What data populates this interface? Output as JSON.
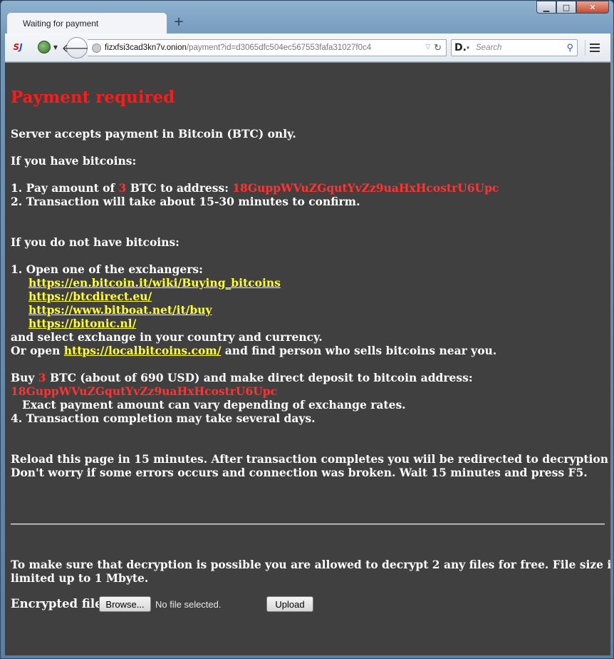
{
  "window": {
    "minimize_label": "▁",
    "maximize_label": "□",
    "close_label": "✕"
  },
  "tab": {
    "title": "Waiting for payment",
    "new_tab_label": "+"
  },
  "toolbar": {
    "addon_icon_text_1": "S",
    "addon_icon_text_2": "J",
    "url_host": "fizxfsi3cad3kn7v.onion",
    "url_path": "/payment?id=d3065dfc504ec567553fafa31027f0c4",
    "search_engine_letter": "D.",
    "search_placeholder": "Search"
  },
  "page": {
    "heading": "Payment required",
    "line_accepts": "Server accepts payment in Bitcoin (BTC) only.",
    "have_bitcoins": "If you have bitcoins:",
    "step1_prefix": "1. Pay amount of ",
    "amount": "3",
    "step1_middle": " BTC to address: ",
    "address": "18GuppWVuZGqutYvZz9uaHxHcostrU6Upc",
    "step2": "2. Transaction will take about 15-30 minutes to confirm.",
    "no_bitcoins": "If you do not have bitcoins:",
    "exch_step1": "1. Open one of the exchangers:",
    "exchangers": [
      "https://en.bitcoin.it/wiki/Buying_bitcoins",
      "https://btcdirect.eu/",
      "https://www.bitboat.net/it/buy",
      "https://bitonic.nl/"
    ],
    "select_exchange": "and select exchange in your country and currency.",
    "or_open_prefix": "Or open ",
    "localbitcoins": "https://localbitcoins.com/",
    "or_open_suffix": " and find person who sells bitcoins near you.",
    "buy_prefix": "Buy ",
    "buy_amount": "3",
    "buy_suffix": " BTC (about of 690 USD) and make direct deposit to bitcoin address:",
    "buy_address": "18GuppWVuZGqutYvZz9uaHxHcostrU6Upc",
    "exact_amount": "Exact payment amount can vary depending of exchange rates.",
    "step4": "4. Transaction completion may take several days.",
    "reload_line1": "Reload this page in 15 minutes. After transaction completes you wiil be redirected to decryption page.",
    "reload_line2": "Don't worry if some errors occurs and connection was broken. Wait 15 minutes and press F5.",
    "free_line1": "To make sure that decryption is possible you are allowed to decrypt 2 any files for free. File size is",
    "free_line2": "limited up to 1 Mbyte.",
    "encrypted_file_label": "Encrypted file:",
    "browse_label": "Browse...",
    "no_file_label": "No file selected.",
    "upload_label": "Upload"
  }
}
